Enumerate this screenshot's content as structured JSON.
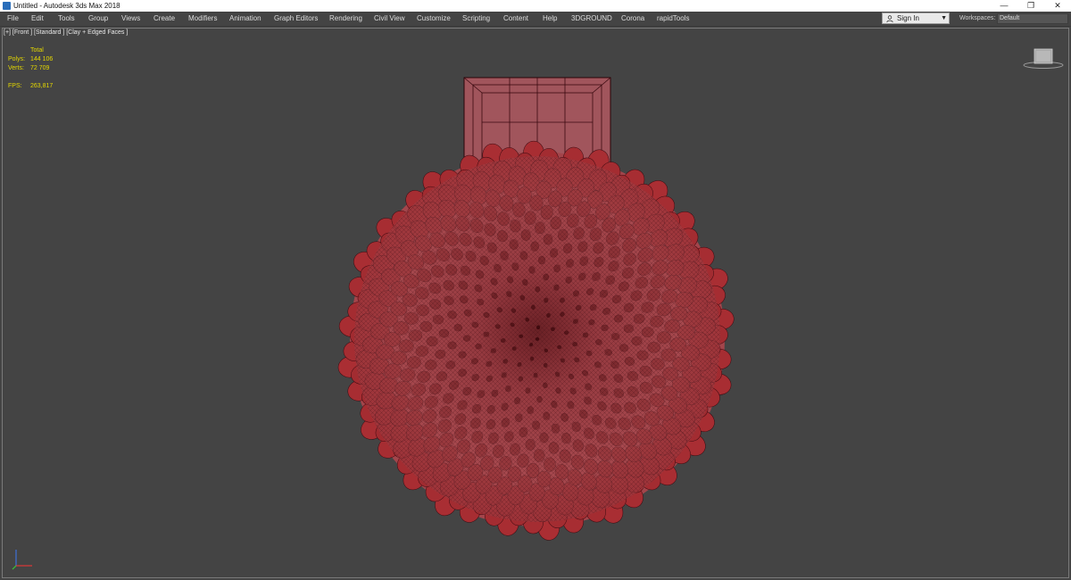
{
  "window": {
    "title": "Untitled - Autodesk 3ds Max 2018",
    "controls": [
      "—",
      "❐",
      "✕"
    ]
  },
  "menu": {
    "items": [
      "File",
      "Edit",
      "Tools",
      "Group",
      "Views",
      "Create",
      "Modifiers",
      "Animation",
      "Graph Editors",
      "Rendering",
      "Civil View",
      "Customize",
      "Scripting",
      "Content",
      "Help",
      "3DGROUND",
      "Corona",
      "rapidTools"
    ]
  },
  "account": {
    "sign_in_label": "Sign In",
    "workspaces_label": "Workspaces:",
    "workspace_value": "Default"
  },
  "viewport": {
    "label": "[+] [Front ] [Standard ] [Clay + Edged Faces ]",
    "stats": {
      "header": "Total",
      "polys_label": "Polys:",
      "polys_value": "144 106",
      "verts_label": "Verts:",
      "verts_value": "72 709",
      "fps_label": "FPS:",
      "fps_value": "263,817"
    }
  },
  "colors": {
    "viewport_bg": "#444444",
    "model_fill": "#a84a4f",
    "model_wire": "#3a0a10",
    "stats_text": "#e5d800"
  }
}
